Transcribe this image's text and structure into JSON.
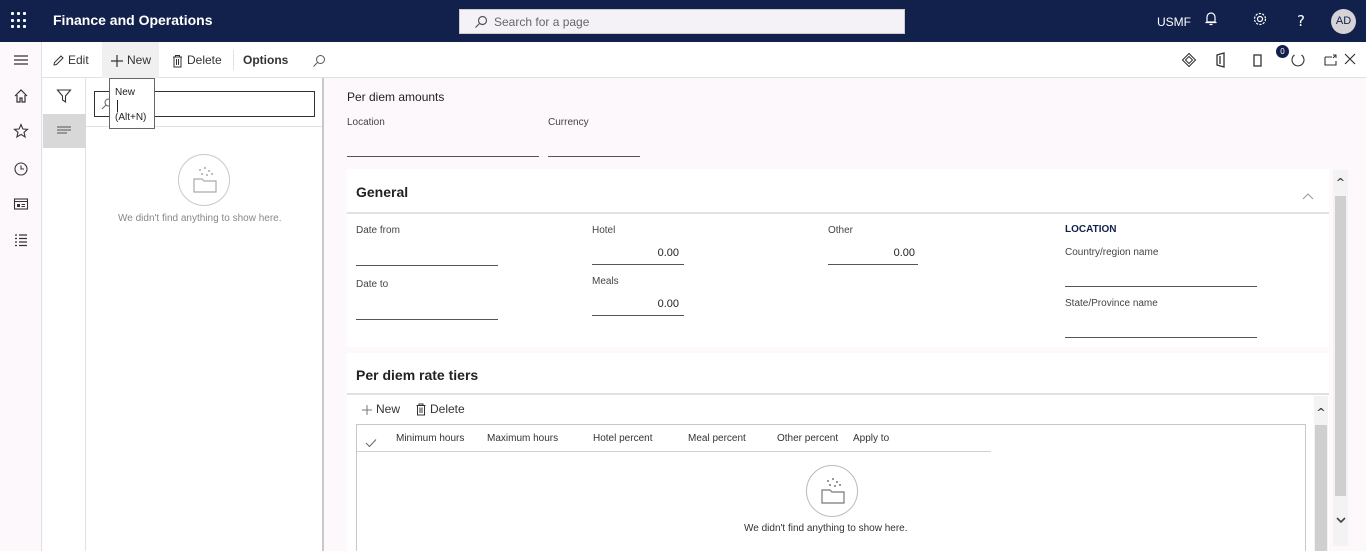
{
  "app": {
    "title": "Finance and Operations",
    "search_placeholder": "Search for a page",
    "company": "USMF",
    "user_initials": "AD"
  },
  "actions": {
    "edit": "Edit",
    "new": "New",
    "delete": "Delete",
    "options": "Options",
    "attachments_count": "0"
  },
  "tooltip": {
    "title": "New",
    "shortcut": "(Alt+N)"
  },
  "list": {
    "filter_value": "",
    "empty_message": "We didn't find anything to show here."
  },
  "header": {
    "title": "Per diem amounts",
    "location_label": "Location",
    "location_value": "",
    "currency_label": "Currency",
    "currency_value": ""
  },
  "general": {
    "title": "General",
    "date_from_label": "Date from",
    "date_from_value": "",
    "date_to_label": "Date to",
    "date_to_value": "",
    "hotel_label": "Hotel",
    "hotel_value": "0.00",
    "meals_label": "Meals",
    "meals_value": "0.00",
    "other_label": "Other",
    "other_value": "0.00",
    "location_group_title": "LOCATION",
    "country_label": "Country/region name",
    "country_value": "",
    "state_label": "State/Province name",
    "state_value": ""
  },
  "tiers": {
    "title": "Per diem rate tiers",
    "new_label": "New",
    "delete_label": "Delete",
    "columns": [
      "Minimum hours",
      "Maximum hours",
      "Hotel percent",
      "Meal percent",
      "Other percent",
      "Apply to"
    ],
    "rows": [],
    "empty_message": "We didn't find anything to show here."
  }
}
